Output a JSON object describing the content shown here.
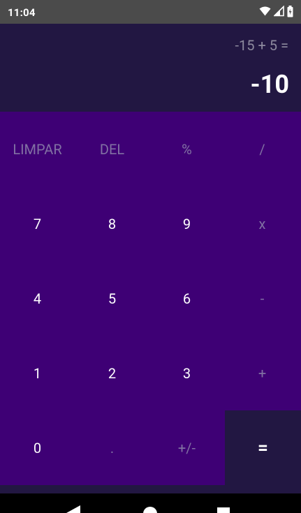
{
  "status_bar": {
    "time": "11:04",
    "icons": [
      "wifi-icon",
      "cell-signal-icon",
      "battery-icon"
    ]
  },
  "display": {
    "expression": "-15 + 5 =",
    "result": "-10"
  },
  "keypad": {
    "clear": "LIMPAR",
    "delete": "DEL",
    "percent": "%",
    "divide": "/",
    "seven": "7",
    "eight": "8",
    "nine": "9",
    "multiply": "x",
    "four": "4",
    "five": "5",
    "six": "6",
    "minus": "-",
    "one": "1",
    "two": "2",
    "three": "3",
    "plus": "+",
    "zero": "0",
    "decimal": ".",
    "negate": "+/-",
    "equals": "="
  },
  "nav_bar": {
    "icons": [
      "back-icon",
      "home-icon",
      "recents-icon"
    ]
  },
  "colors": {
    "display_bg": "#221742",
    "keypad_bg": "#3e0075",
    "key_text": "#ffffff",
    "muted_key_text": "#8170a3",
    "expression_text": "#8d8a9e",
    "status_bar_bg": "#4b4b4b"
  }
}
